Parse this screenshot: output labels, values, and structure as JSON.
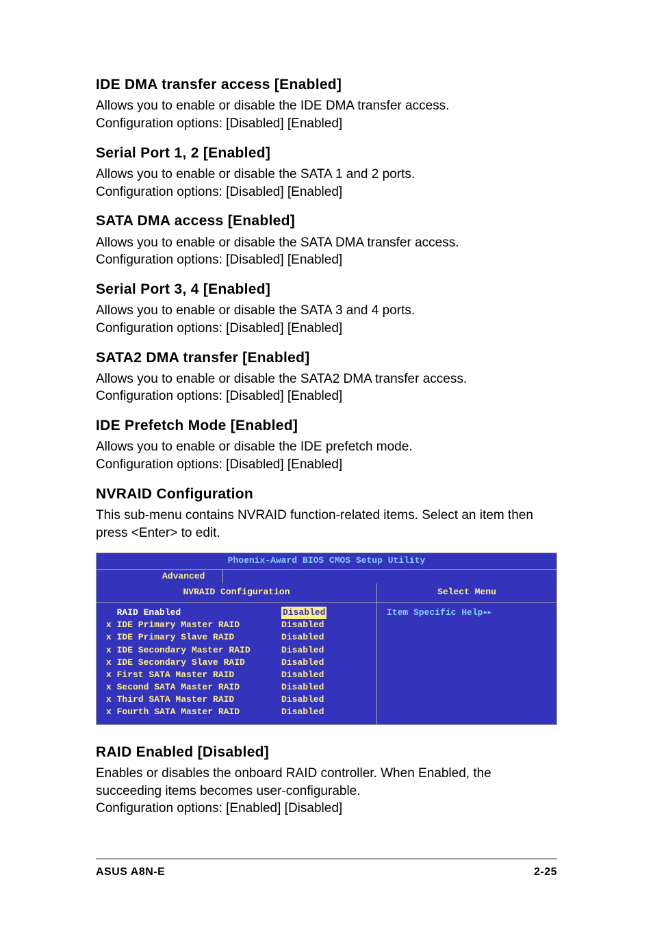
{
  "sections": [
    {
      "title": "IDE DMA transfer access [Enabled]",
      "body": "Allows you to enable or disable the IDE DMA transfer access.\nConfiguration options: [Disabled] [Enabled]"
    },
    {
      "title": "Serial Port 1, 2 [Enabled]",
      "body": "Allows you to enable or disable the SATA 1 and 2 ports.\nConfiguration options: [Disabled] [Enabled]"
    },
    {
      "title": "SATA DMA access [Enabled]",
      "body": "Allows you to enable or disable the SATA DMA transfer access.\nConfiguration options: [Disabled] [Enabled]"
    },
    {
      "title": "Serial Port 3, 4 [Enabled]",
      "body": "Allows you to enable or disable the SATA 3 and 4 ports.\nConfiguration options: [Disabled] [Enabled]"
    },
    {
      "title": "SATA2 DMA transfer [Enabled]",
      "body": "Allows you to enable or disable the SATA2 DMA transfer access.\nConfiguration options: [Disabled] [Enabled]"
    },
    {
      "title": "IDE Prefetch Mode [Enabled]",
      "body": "Allows you to enable or disable the IDE prefetch mode.\nConfiguration options: [Disabled] [Enabled]"
    },
    {
      "title": "NVRAID Configuration",
      "body": "This sub-menu contains NVRAID function-related items. Select an item then press <Enter> to edit."
    }
  ],
  "bios": {
    "title": "Phoenix-Award BIOS CMOS Setup Utility",
    "tab": "Advanced",
    "left_header": "NVRAID Configuration",
    "right_header": "Select Menu",
    "right_body": "Item Specific Help",
    "items": [
      {
        "prefix": "  ",
        "label": "RAID Enabled",
        "value": "Disabled",
        "selected": true
      },
      {
        "prefix": "x ",
        "label": "IDE Primary Master RAID",
        "value": "Disabled",
        "selected": false
      },
      {
        "prefix": "x ",
        "label": "IDE Primary Slave RAID",
        "value": "Disabled",
        "selected": false
      },
      {
        "prefix": "x ",
        "label": "IDE Secondary Master RAID",
        "value": "Disabled",
        "selected": false
      },
      {
        "prefix": "x ",
        "label": "IDE Secondary Slave RAID",
        "value": "Disabled",
        "selected": false
      },
      {
        "prefix": "x ",
        "label": "First SATA Master RAID",
        "value": "Disabled",
        "selected": false
      },
      {
        "prefix": "x ",
        "label": "Second SATA Master RAID",
        "value": "Disabled",
        "selected": false
      },
      {
        "prefix": "x ",
        "label": "Third SATA Master RAID",
        "value": "Disabled",
        "selected": false
      },
      {
        "prefix": "x ",
        "label": "Fourth SATA Master RAID",
        "value": "Disabled",
        "selected": false
      }
    ]
  },
  "section_after": {
    "title": "RAID Enabled [Disabled]",
    "body": "Enables or disables the onboard RAID controller. When Enabled, the succeeding items becomes user-configurable.\nConfiguration options: [Enabled] [Disabled]"
  },
  "footer": {
    "left": "ASUS A8N-E",
    "right": "2-25"
  }
}
